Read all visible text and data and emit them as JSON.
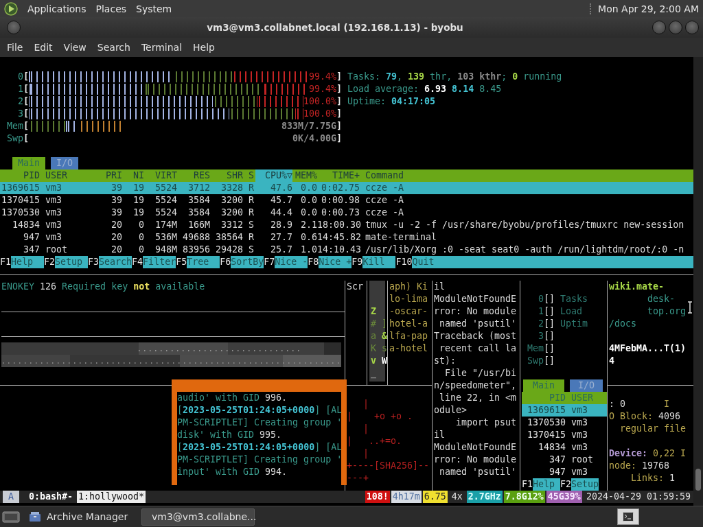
{
  "top_panel": {
    "menus": [
      "Applications",
      "Places",
      "System"
    ],
    "clock": "Mon Apr 29,  2:00 AM"
  },
  "window": {
    "title": "vm3@vm3.collabnet.local (192.168.1.13) - byobu"
  },
  "menu": [
    "File",
    "Edit",
    "View",
    "Search",
    "Terminal",
    "Help"
  ],
  "htop": {
    "meters": [
      {
        "label": "0",
        "open": "[",
        "reading": "99.4%",
        "close": "]",
        "kind": "cpu"
      },
      {
        "label": "1",
        "open": "[",
        "reading": "99.4%",
        "close": "]",
        "kind": "cpu"
      },
      {
        "label": "2",
        "open": "[",
        "reading": "100.0%",
        "close": "]",
        "kind": "cpu"
      },
      {
        "label": "3",
        "open": "[",
        "reading": "100.0%",
        "close": "]",
        "kind": "cpu"
      },
      {
        "label": "Mem",
        "open": "[",
        "reading": "833M/7.75G",
        "close": "]",
        "kind": "mem"
      },
      {
        "label": "Swp",
        "open": "[",
        "reading": "0K/4.00G",
        "close": "]",
        "kind": "mem"
      }
    ],
    "summary": [
      [
        {
          "text": "Tasks: ",
          "kind": "label"
        },
        {
          "text": "79",
          "kind": "value"
        },
        {
          "text": ", ",
          "kind": "label"
        },
        {
          "text": "139",
          "kind": "good"
        },
        {
          "text": " thr, ",
          "kind": "label"
        },
        {
          "text": "103 kthr",
          "kind": "muted"
        },
        {
          "text": "; ",
          "kind": "label"
        },
        {
          "text": "0",
          "kind": "good"
        },
        {
          "text": " running",
          "kind": "label"
        }
      ],
      [
        {
          "text": "Load average: ",
          "kind": "label"
        },
        {
          "text": "6.93",
          "kind": "strong"
        },
        {
          "text": " 8.14",
          "kind": "value"
        },
        {
          "text": " 8.45",
          "kind": "label"
        }
      ],
      [
        {
          "text": "Uptime: ",
          "kind": "label"
        },
        {
          "text": "04:17:05",
          "kind": "value"
        }
      ]
    ],
    "tabs": [
      {
        "label": "Main",
        "selected": true
      },
      {
        "label": "I/O",
        "selected": false
      }
    ],
    "columns": [
      {
        "label": "PID",
        "sorted": false
      },
      {
        "label": "USER",
        "sorted": false
      },
      {
        "label": "PRI",
        "sorted": false
      },
      {
        "label": "NI",
        "sorted": false
      },
      {
        "label": "VIRT",
        "sorted": false
      },
      {
        "label": "RES",
        "sorted": false
      },
      {
        "label": "SHR",
        "sorted": false
      },
      {
        "label": "S",
        "sorted": false
      },
      {
        "label": "CPU%▽",
        "sorted": true
      },
      {
        "label": "MEM%",
        "sorted": false
      },
      {
        "label": "TIME+",
        "sorted": false
      },
      {
        "label": "Command",
        "sorted": false
      }
    ],
    "rows": [
      {
        "selected": true,
        "cells": [
          "1369615",
          "vm3",
          "39",
          "19",
          "5524",
          "3712",
          "3328",
          "R",
          "47.6",
          "0.0",
          "0:02.75",
          "ccze -A"
        ]
      },
      {
        "selected": false,
        "cells": [
          "1370415",
          "vm3",
          "39",
          "19",
          "5524",
          "3584",
          "3200",
          "R",
          "45.7",
          "0.0",
          "0:00.98",
          "ccze -A"
        ]
      },
      {
        "selected": false,
        "cells": [
          "1370530",
          "vm3",
          "39",
          "19",
          "5524",
          "3584",
          "3200",
          "R",
          "44.4",
          "0.0",
          "0:00.73",
          "ccze -A"
        ]
      },
      {
        "selected": false,
        "cells": [
          "14834",
          "vm3",
          "20",
          "0",
          "174M",
          "166M",
          "3312",
          "S",
          "28.9",
          "2.1",
          "18:00.30",
          "tmux -u -2 -f /usr/share/byobu/profiles/tmuxrc new-session"
        ]
      },
      {
        "selected": false,
        "cells": [
          "947",
          "vm3",
          "20",
          "0",
          "536M",
          "49688",
          "38564",
          "R",
          "27.7",
          "0.6",
          "14:45.82",
          "mate-terminal"
        ]
      },
      {
        "selected": false,
        "cells": [
          "347",
          "root",
          "20",
          "0",
          "948M",
          "83956",
          "29428",
          "S",
          "25.7",
          "1.0",
          "14:10.43",
          "/usr/lib/Xorg :0 -seat seat0 -auth /run/lightdm/root/:0 -n"
        ]
      }
    ],
    "function_keys": [
      {
        "key": "F1",
        "label": "Help"
      },
      {
        "key": "F2",
        "label": "Setup"
      },
      {
        "key": "F3",
        "label": "Search"
      },
      {
        "key": "F4",
        "label": "Filter"
      },
      {
        "key": "F5",
        "label": "Tree"
      },
      {
        "key": "F6",
        "label": "SortBy"
      },
      {
        "key": "F7",
        "label": "Nice -"
      },
      {
        "key": "F8",
        "label": "Nice +"
      },
      {
        "key": "F9",
        "label": "Kill"
      },
      {
        "key": "F10",
        "label": "Quit"
      }
    ]
  },
  "panes": {
    "error_pane": {
      "lines": [
        [
          {
            "text": "ENOKEY",
            "kind": "label"
          },
          {
            "text": " 126 ",
            "kind": "text"
          },
          {
            "text": "Required key ",
            "kind": "label"
          },
          {
            "text": "not",
            "kind": "warn"
          },
          {
            "text": " available",
            "kind": "label"
          }
        ]
      ]
    },
    "scr_pane": {
      "lines": [
        [
          {
            "text": "Scr",
            "kind": "text"
          }
        ]
      ]
    },
    "glyph_pane": {
      "lines": [
        [
          {
            "text": "Z",
            "kind": "good"
          }
        ],
        [
          {
            "text": "# ]",
            "kind": "dimgreen"
          }
        ],
        [
          {
            "text": "a ",
            "kind": "dimgreen"
          },
          {
            "text": "&",
            "kind": "good"
          }
        ],
        [
          {
            "text": "K s",
            "kind": "dimgreen"
          }
        ],
        [
          {
            "text": "v",
            "kind": "good"
          },
          {
            "text": " W",
            "kind": "strong"
          }
        ],
        [
          {
            "text": "_",
            "kind": "muted"
          }
        ]
      ]
    },
    "callsign_pane": {
      "lines": [
        [
          {
            "text": "aph) Ki",
            "kind": "olive"
          }
        ],
        [
          {
            "text": "lo-lima",
            "kind": "olive"
          }
        ],
        [
          {
            "text": "-oscar-",
            "kind": "olive"
          }
        ],
        [
          {
            "text": "hotel-a",
            "kind": "olive"
          }
        ],
        [
          {
            "text": "lfa-pap",
            "kind": "olive"
          }
        ],
        [
          {
            "text": "a-hotel",
            "kind": "olive"
          }
        ]
      ]
    },
    "python_pane": {
      "lines": [
        [
          {
            "text": "il",
            "kind": "text"
          }
        ],
        [
          {
            "text": "ModuleNotFoundE",
            "kind": "text"
          }
        ],
        [
          {
            "text": "rror: No module",
            "kind": "text"
          }
        ],
        [
          {
            "text": " named 'psutil'",
            "kind": "text"
          }
        ],
        [
          {
            "text": "Traceback (most",
            "kind": "text"
          }
        ],
        [
          {
            "text": " recent call la",
            "kind": "text"
          }
        ],
        [
          {
            "text": "st):",
            "kind": "text"
          }
        ],
        [
          {
            "text": "  File \"/usr/bi",
            "kind": "text"
          }
        ],
        [
          {
            "text": "n/speedometer\",",
            "kind": "text"
          }
        ],
        [
          {
            "text": " line 22, in <m",
            "kind": "text"
          }
        ],
        [
          {
            "text": "odule>",
            "kind": "text"
          }
        ],
        [
          {
            "text": "    import psut",
            "kind": "text"
          }
        ],
        [
          {
            "text": "il",
            "kind": "text"
          }
        ],
        [
          {
            "text": "ModuleNotFoundE",
            "kind": "text"
          }
        ],
        [
          {
            "text": "rror: No module",
            "kind": "text"
          }
        ],
        [
          {
            "text": " named 'psutil'",
            "kind": "text"
          }
        ]
      ]
    },
    "mini_htop": {
      "meters": [
        {
          "label": "0",
          "bar": "[]",
          "text": "Tasks"
        },
        {
          "label": "1",
          "bar": "[]",
          "text": "Load"
        },
        {
          "label": "2",
          "bar": "[]",
          "text": "Uptim"
        },
        {
          "label": "3",
          "bar": "[]"
        },
        {
          "label": "Mem",
          "bar": "[]"
        },
        {
          "label": "Swp",
          "bar": "[]"
        }
      ],
      "tabs": [
        {
          "label": "Main",
          "selected": true
        },
        {
          "label": "I/O",
          "selected": false
        }
      ],
      "columns": [
        "PID",
        "USER"
      ],
      "rows": [
        {
          "selected": true,
          "cells": [
            "1369615",
            "vm3"
          ]
        },
        {
          "selected": false,
          "cells": [
            "1370530",
            "vm3"
          ]
        },
        {
          "selected": false,
          "cells": [
            "1370415",
            "vm3"
          ]
        },
        {
          "selected": false,
          "cells": [
            "14834",
            "vm3"
          ]
        },
        {
          "selected": false,
          "cells": [
            "347",
            "root"
          ]
        },
        {
          "selected": false,
          "cells": [
            "947",
            "vm3"
          ]
        }
      ],
      "function_keys": [
        {
          "key": "F1",
          "label": "Help"
        },
        {
          "key": "F2",
          "label": "Setup"
        }
      ]
    },
    "docs_pane": {
      "lines": [
        [
          {
            "text": "wiki.mate-",
            "kind": "good"
          }
        ],
        [
          {
            "text": "       desk-",
            "kind": "label"
          }
        ],
        [
          {
            "text": "       top.org",
            "kind": "label"
          }
        ],
        [
          {
            "text": "/docs",
            "kind": "label"
          }
        ]
      ],
      "details": [
        [
          {
            "text": "4MFebMA...T(1)",
            "kind": "strong"
          }
        ],
        [
          {
            "text": "4",
            "kind": "strong"
          }
        ]
      ]
    },
    "hash_pane": {
      "lines": [
        [
          {
            "text": "   |",
            "kind": "alert"
          }
        ],
        [
          {
            "text": "|    +o +o .",
            "kind": "alert"
          }
        ],
        [
          {
            "text": "   |",
            "kind": "alert"
          }
        ],
        [
          {
            "text": "|   ..+=o.",
            "kind": "alert"
          }
        ],
        [
          {
            "text": "   |",
            "kind": "alert"
          }
        ],
        [
          {
            "text": "+----[SHA256]--",
            "kind": "alert"
          }
        ],
        [
          {
            "text": "---+",
            "kind": "alert"
          }
        ]
      ]
    },
    "stat_pane": {
      "lines": [
        [
          {
            "text": ": 0",
            "kind": "text"
          },
          {
            "text": "       I",
            "kind": "olive"
          }
        ],
        [
          {
            "text": "O Block: ",
            "kind": "olive"
          },
          {
            "text": "4096",
            "kind": "text"
          }
        ],
        [
          {
            "text": "  regular file",
            "kind": "olive"
          }
        ]
      ],
      "device_lines": [
        [
          {
            "text": "Device:",
            "kind": "purple"
          },
          {
            "text": " 0,22 I",
            "kind": "olive"
          }
        ],
        [
          {
            "text": "node: ",
            "kind": "olive"
          },
          {
            "text": "19768",
            "kind": "text"
          }
        ],
        [
          {
            "text": "    Links: ",
            "kind": "olive"
          },
          {
            "text": "1",
            "kind": "text"
          }
        ]
      ]
    },
    "log_popup": {
      "lines": [
        [
          {
            "text": "audio' with GID ",
            "kind": "label"
          },
          {
            "text": "996.",
            "kind": "text"
          }
        ],
        [
          {
            "text": "[",
            "kind": "label"
          },
          {
            "text": "2023-05-25T01:24:05+0000",
            "kind": "value"
          },
          {
            "text": "] [AL",
            "kind": "label"
          }
        ],
        [
          {
            "text": "PM-SCRIPTLET] Creating group '",
            "kind": "label"
          }
        ],
        [
          {
            "text": "disk' with GID ",
            "kind": "label"
          },
          {
            "text": "995.",
            "kind": "text"
          }
        ],
        [
          {
            "text": "[",
            "kind": "label"
          },
          {
            "text": "2023-05-25T01:24:05+0000",
            "kind": "value"
          },
          {
            "text": "] [AL",
            "kind": "label"
          }
        ],
        [
          {
            "text": "PM-SCRIPTLET] Creating group '",
            "kind": "label"
          }
        ],
        [
          {
            "text": "input' with GID ",
            "kind": "label"
          },
          {
            "text": "994.",
            "kind": "text"
          }
        ]
      ]
    }
  },
  "status_bar": {
    "session": "A",
    "windows": [
      {
        "label": "0:bash#-",
        "selected": false
      },
      {
        "label": "1:hollywood*",
        "selected": true
      }
    ],
    "indicators": [
      {
        "text": "108!",
        "kind": "alert"
      },
      {
        "text": "4h17m",
        "kind": "uptime"
      },
      {
        "text": "6.75",
        "kind": "load"
      },
      {
        "text": "4x",
        "kind": "plain"
      },
      {
        "text": "2.7GHz",
        "kind": "cpu"
      },
      {
        "text": "7.8G12%",
        "kind": "mem"
      },
      {
        "text": "45G39%",
        "kind": "disk"
      },
      {
        "text": "2024-04-29 01:59:59",
        "kind": "plain"
      }
    ]
  },
  "taskbar": {
    "items": [
      {
        "label": "Archive Manager",
        "selected": false,
        "kind": "archive"
      },
      {
        "label": "vm3@vm3.collabne...",
        "selected": true,
        "kind": "terminal"
      }
    ]
  }
}
